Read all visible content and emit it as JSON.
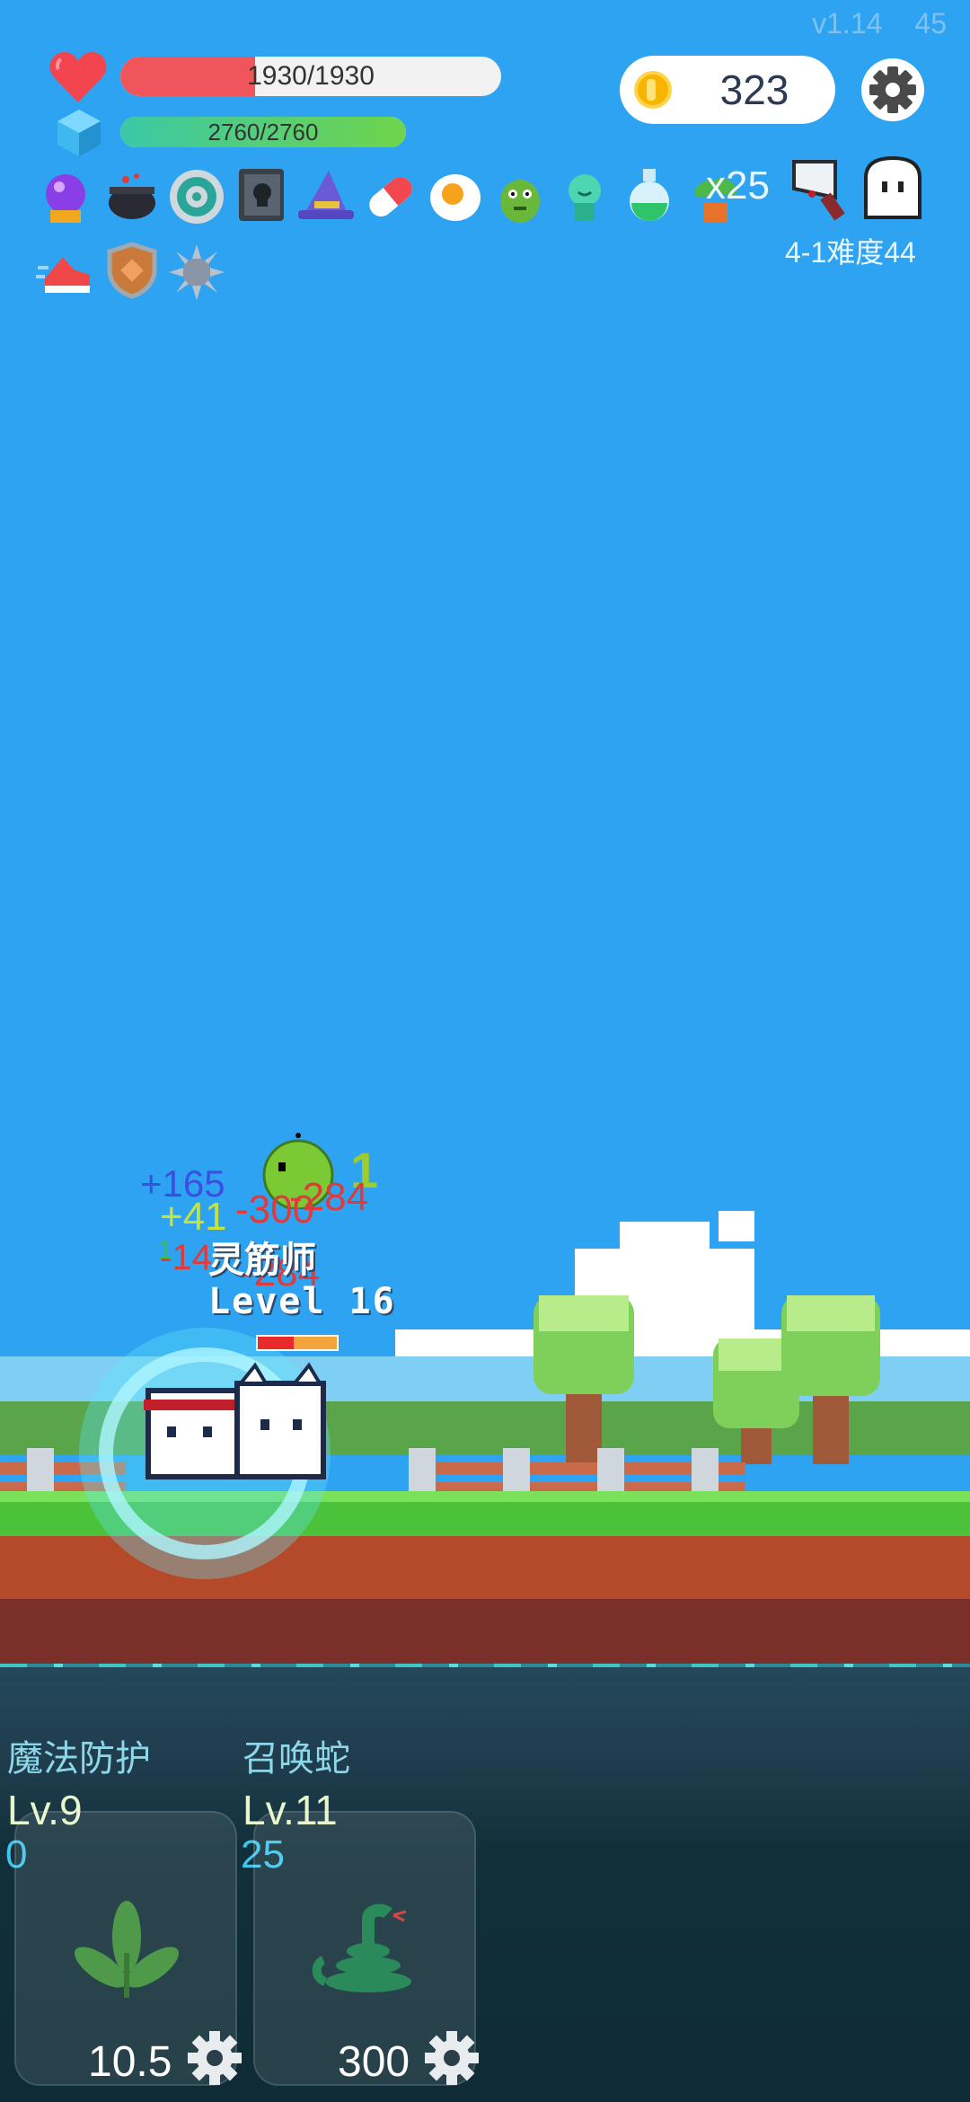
{
  "version": {
    "label": "v1.14",
    "fps": "45"
  },
  "hp": {
    "text": "1930/1930",
    "current": 1930,
    "max": 1930
  },
  "mp": {
    "text": "2760/2760",
    "current": 2760,
    "max": 2760
  },
  "coins": {
    "value": "323"
  },
  "buffs": {
    "row1": [
      "crystal-ball-icon",
      "cauldron-icon",
      "disc-icon",
      "skull-book-icon",
      "wizard-hat-icon",
      "pill-icon",
      "fried-egg-icon",
      "green-monster-icon",
      "green-spirit-icon",
      "potion-icon",
      "herb-plant-icon",
      "cleaver-icon",
      "ghost-icon"
    ],
    "row2": [
      "running-shoe-icon",
      "shield-icon",
      "spiked-ball-icon"
    ],
    "plant_count": "x25"
  },
  "stage": {
    "label": "4-1难度44"
  },
  "battle": {
    "floating_texts": [
      {
        "text": "+165",
        "color": "#3b4fe0"
      },
      {
        "text": "1",
        "color": "#9ccc2d"
      },
      {
        "text": "-284",
        "color": "#e03a3a"
      },
      {
        "text": "+41",
        "color": "#c7e23a"
      },
      {
        "text": "-300",
        "color": "#e03a3a"
      },
      {
        "text": "-14",
        "color": "#e03a3a"
      },
      {
        "text": "-284",
        "color": "#e03a3a"
      },
      {
        "text": "1",
        "color": "#3fbf3f"
      }
    ],
    "enemy": {
      "name": "灵筋师",
      "level": "Level 16",
      "hp_fraction": 0.45
    }
  },
  "skills": [
    {
      "name": "魔法防护",
      "level": "Lv.9",
      "sub": "0",
      "cost": "10.5",
      "icon": "leaf-sprout-icon"
    },
    {
      "name": "召唤蛇",
      "level": "Lv.11",
      "sub": "25",
      "cost": "300",
      "icon": "snake-icon"
    }
  ],
  "colors": {
    "sky": "#2ea3f2",
    "grass": "#4cc23a",
    "dirt": "#b54a2a",
    "panel": "#0f2c36"
  }
}
